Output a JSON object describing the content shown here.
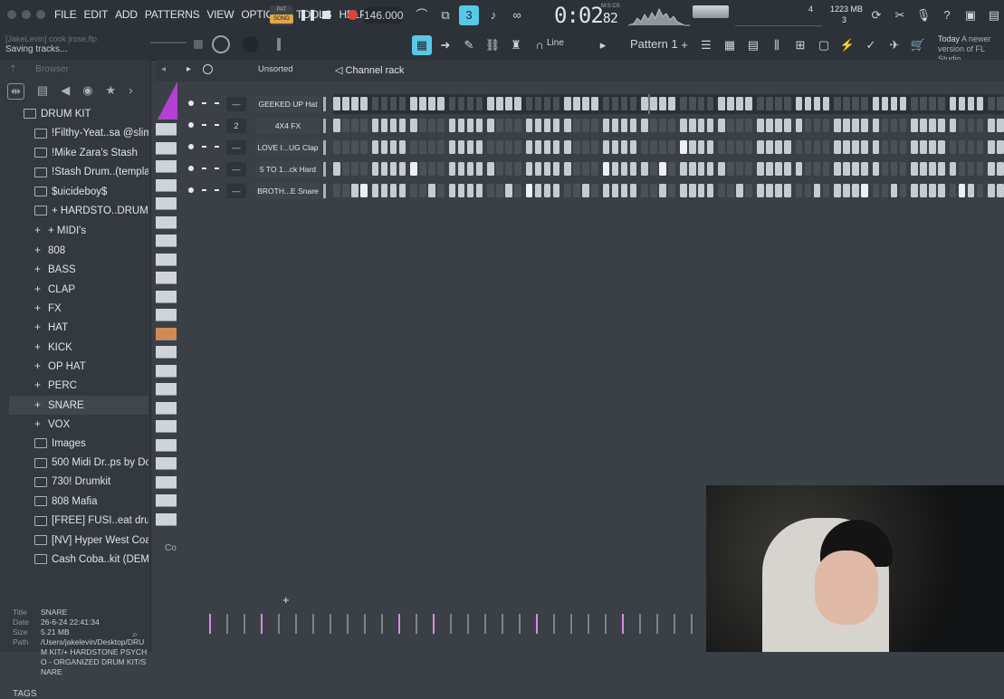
{
  "menu": [
    "FILE",
    "EDIT",
    "ADD",
    "PATTERNS",
    "VIEW",
    "OPTIONS",
    "TOOLS",
    "HELP"
  ],
  "transport": {
    "mode_top": "PAT",
    "mode_bottom": "SONG",
    "tempo": "146.000",
    "time_main": "0:02",
    "time_ms": "82",
    "time_label": "M:S:CS"
  },
  "status": {
    "memory": "1223 MB",
    "cpu": "3",
    "voices": "4"
  },
  "project": {
    "file": "[JakeLevin] cook jrose.flp",
    "hint": "Saving tracks..."
  },
  "toolbar2": {
    "snap": "Line",
    "pattern": "Pattern 1"
  },
  "news": {
    "date": "Today",
    "text": "A newer version of FL Studio"
  },
  "browser": {
    "title": "Browser",
    "items": [
      {
        "label": "DRUM KIT",
        "type": "folder"
      },
      {
        "label": "!Filthy-Yeat..sa @slimejax",
        "type": "folder"
      },
      {
        "label": "!Mike Zara's Stash",
        "type": "folder"
      },
      {
        "label": "!Stash Drum..(template)",
        "type": "folder"
      },
      {
        "label": "$uicideboy$",
        "type": "folder"
      },
      {
        "label": "+ HARDSTO..DRUM KIT",
        "type": "folder"
      },
      {
        "label": "+ MIDI's",
        "type": "sub"
      },
      {
        "label": "808",
        "type": "sub"
      },
      {
        "label": "BASS",
        "type": "sub"
      },
      {
        "label": "CLAP",
        "type": "sub"
      },
      {
        "label": "FX",
        "type": "sub"
      },
      {
        "label": "HAT",
        "type": "sub"
      },
      {
        "label": "KICK",
        "type": "sub"
      },
      {
        "label": "OP HAT",
        "type": "sub"
      },
      {
        "label": "PERC",
        "type": "sub"
      },
      {
        "label": "SNARE",
        "type": "sub",
        "selected": true
      },
      {
        "label": "VOX",
        "type": "sub"
      },
      {
        "label": "Images",
        "type": "folder"
      },
      {
        "label": "500 Midi Dr..ps by Donit",
        "type": "folder"
      },
      {
        "label": "730! Drumkit",
        "type": "folder"
      },
      {
        "label": "808 Mafia",
        "type": "folder"
      },
      {
        "label": "[FREE] FUSI..eat drumkit",
        "type": "folder"
      },
      {
        "label": "[NV] Hyper West Coast",
        "type": "folder"
      },
      {
        "label": "Cash Coba..kit (DEMO)",
        "type": "folder"
      }
    ],
    "info": {
      "title_k": "Title",
      "title_v": "SNARE",
      "date_k": "Date",
      "date_v": "26-6-24 22:41:34",
      "size_k": "Size",
      "size_v": "5.21 MB",
      "path_k": "Path",
      "path_v": "/Users/jakelevin/Desktop/DRUM KIT/+ HARDSTONE PSYCHO - ORGANIZED DRUM KIT/SNARE"
    },
    "tags": "TAGS"
  },
  "rack": {
    "sort": "Unsorted",
    "title": "Channel rack",
    "channels": [
      {
        "name": "GEEKED UP Hat",
        "num": "—"
      },
      {
        "name": "4X4 FX",
        "num": "2"
      },
      {
        "name": "LOVE I...UG Clap",
        "num": "—"
      },
      {
        "name": "5 TO 1...ck Hard",
        "num": "—"
      },
      {
        "name": "BROTH...E Snare",
        "num": "—"
      }
    ]
  }
}
